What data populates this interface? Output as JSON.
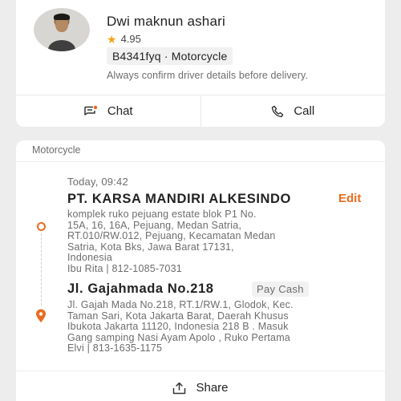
{
  "driver": {
    "name": "Dwi maknun ashari",
    "rating": "4.95",
    "plate": "B4341fyq · Motorcycle",
    "note": "Always confirm driver details before delivery.",
    "chat_label": "Chat",
    "call_label": "Call"
  },
  "order": {
    "vehicle": "Motorcycle",
    "time": "Today, 09:42",
    "pickup": {
      "title": "PT. KARSA MANDIRI ALKESINDO",
      "address_lines": [
        "komplek ruko pejuang estate blok P1 No.",
        "15A, 16, 16A, Pejuang, Medan Satria,",
        "RT.010/RW.012, Pejuang, Kecamatan Medan",
        "Satria, Kota Bks, Jawa Barat 17131,",
        "Indonesia",
        "Ibu Rita  |  812-1085-7031"
      ],
      "edit_label": "Edit"
    },
    "dropoff": {
      "title": "Jl. Gajahmada No.218",
      "payment_label": "Pay Cash",
      "address_lines": [
        "Jl. Gajah Mada No.218, RT.1/RW.1, Glodok, Kec.",
        "Taman Sari, Kota Jakarta Barat, Daerah Khusus",
        "Ibukota Jakarta 11120, Indonesia 218 B . Masuk",
        "Gang samping Nasi Ayam Apolo , Ruko Pertama",
        "Elvi  |  813-1635-1175"
      ]
    },
    "share_label": "Share"
  },
  "icons": {
    "star": "star-icon",
    "chat": "chat-icon",
    "call": "phone-icon",
    "share": "share-icon",
    "pin": "location-pin-icon"
  },
  "colors": {
    "accent": "#ea6b1f",
    "star": "#f2a516",
    "muted_text": "#6d6d6d",
    "background": "#ededed"
  }
}
